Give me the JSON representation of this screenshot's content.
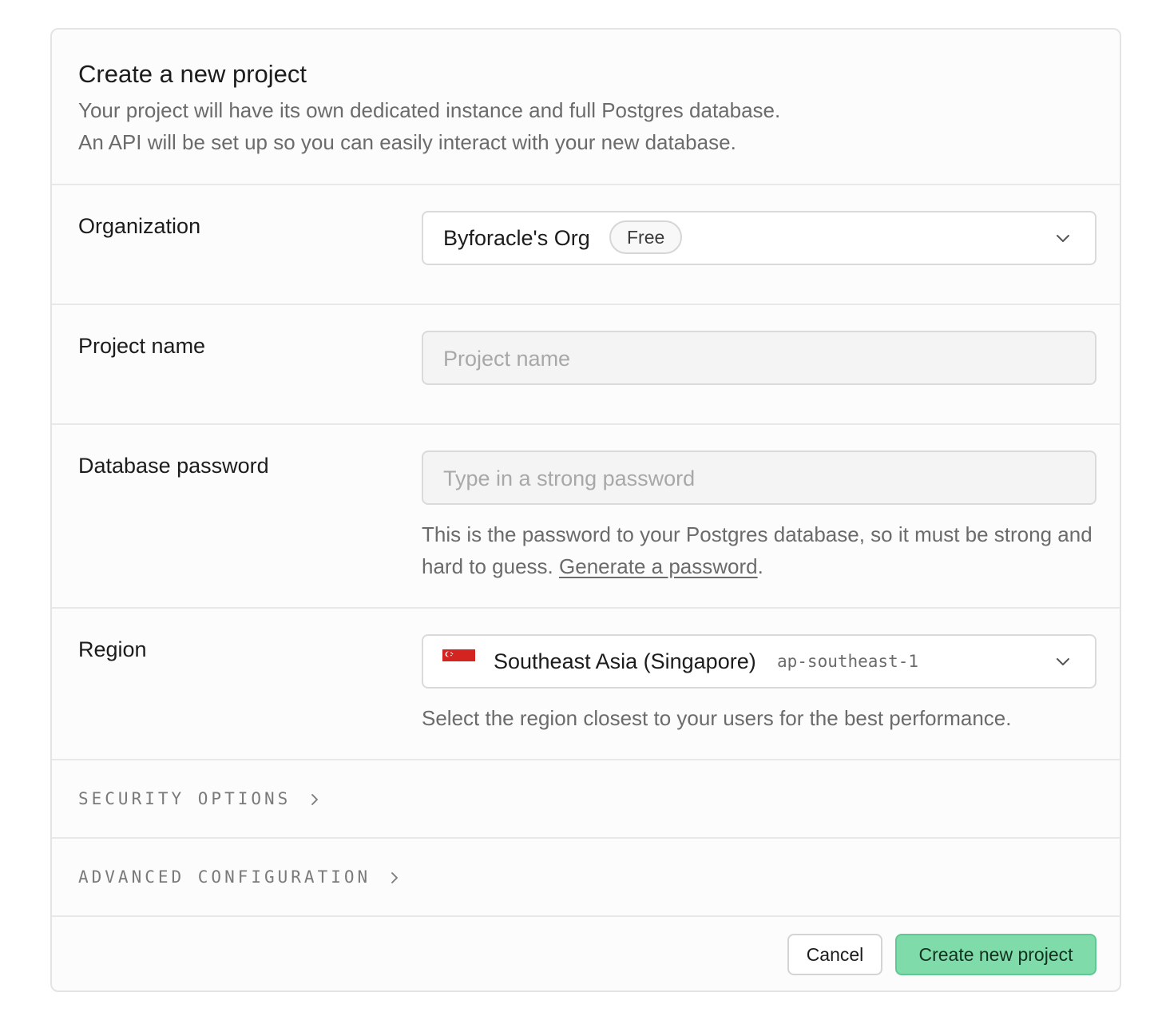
{
  "header": {
    "title": "Create a new project",
    "subtitle_line1": "Your project will have its own dedicated instance and full Postgres database.",
    "subtitle_line2": "An API will be set up so you can easily interact with your new database."
  },
  "organization": {
    "label": "Organization",
    "selected": "Byforacle's Org",
    "plan_badge": "Free",
    "icon": "chevron-down-icon"
  },
  "project_name": {
    "label": "Project name",
    "value": "",
    "placeholder": "Project name"
  },
  "database_password": {
    "label": "Database password",
    "value": "",
    "placeholder": "Type in a strong password",
    "help_text": "This is the password to your Postgres database, so it must be strong and hard to guess.",
    "generate_link": "Generate a password",
    "help_suffix": "."
  },
  "region": {
    "label": "Region",
    "selected": "Southeast Asia (Singapore)",
    "code": "ap-southeast-1",
    "flag_icon": "singapore-flag-icon",
    "help_text": "Select the region closest to your users for the best performance."
  },
  "security_options": {
    "label": "SECURITY OPTIONS",
    "icon": "chevron-right-icon"
  },
  "advanced_configuration": {
    "label": "ADVANCED CONFIGURATION",
    "icon": "chevron-right-icon"
  },
  "footer": {
    "cancel_label": "Cancel",
    "create_label": "Create new project"
  },
  "colors": {
    "primary_button": "#7fdcaa",
    "primary_border": "#5fc893",
    "flag_red": "#d32420"
  }
}
